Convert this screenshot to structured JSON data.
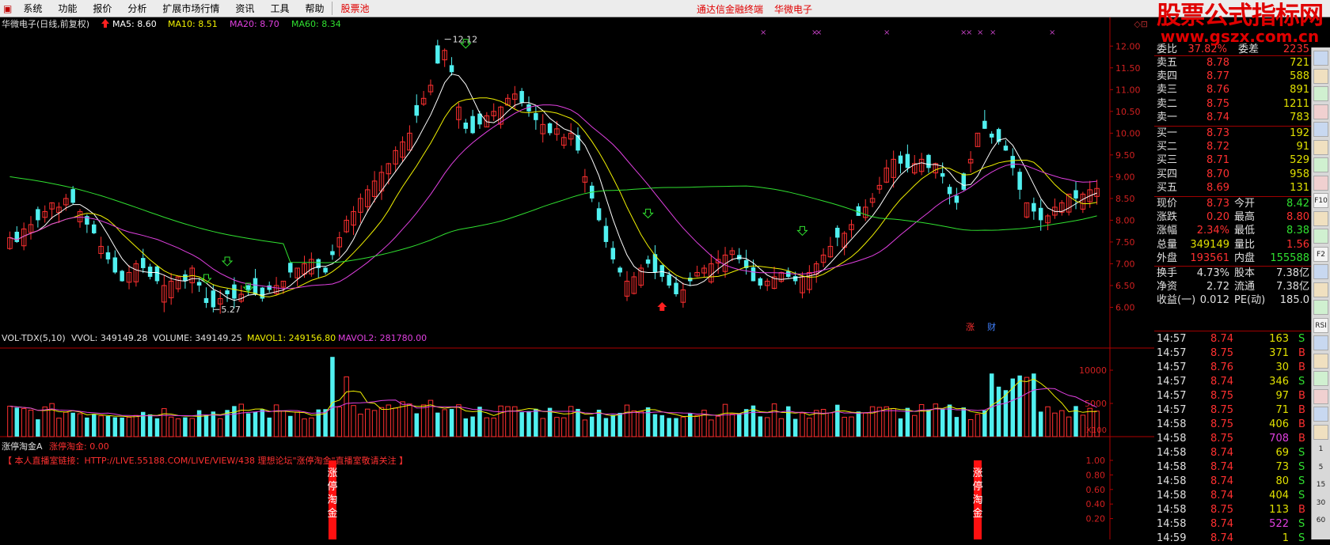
{
  "menu": {
    "items": [
      "系统",
      "功能",
      "报价",
      "分析",
      "扩展市场行情",
      "资讯",
      "工具",
      "帮助"
    ],
    "active": "股票池",
    "center": [
      "通达信金融终端",
      "华微电子"
    ]
  },
  "watermark": {
    "line1": "股票公式指标网",
    "line2": "www.gszx.com.cn"
  },
  "main_chart": {
    "title": "华微电子(日线,前复权)",
    "ma": [
      {
        "label": "MA5: 8.60",
        "color": "#ffffff"
      },
      {
        "label": "MA10: 8.51",
        "color": "#f0f000"
      },
      {
        "label": "MA20: 8.70",
        "color": "#e040e0"
      },
      {
        "label": "MA60: 8.34",
        "color": "#30e030"
      }
    ],
    "high_label": "12.12",
    "low_label": "5.27",
    "tags": [
      "涨",
      "财"
    ],
    "price_ticks": [
      "12.00",
      "11.50",
      "11.00",
      "10.50",
      "10.00",
      "9.50",
      "9.00",
      "8.50",
      "8.00",
      "7.50",
      "7.00",
      "6.50",
      "6.00"
    ],
    "top_icons": "◇⊡"
  },
  "volume_chart": {
    "title": "VOL-TDX(5,10)",
    "vvol": "VVOL: 349149.28",
    "volume": "VOLUME: 349149.25",
    "mavol1": "MAVOL1: 249156.80",
    "mavol2": "MAVOL2: 281780.00",
    "ticks": [
      "10000",
      "5000"
    ],
    "unit": "X100"
  },
  "indicator": {
    "title": "涨停淘金A",
    "value": "涨停淘金: 0.00",
    "notice": "【 本人直播室链接：HTTP://LIVE.55188.COM/LIVE/VIEW/438 理想论坛\"涨停淘金\"直播室敬请关注 】",
    "ticks": [
      "1.00",
      "0.80",
      "0.60",
      "0.40",
      "0.20"
    ],
    "signal_text": "涨停淘金"
  },
  "chart_data": {
    "type": "candlestick",
    "price_axis": {
      "min": 5.27,
      "max": 12.12,
      "ticks": [
        12.0,
        11.5,
        11.0,
        10.5,
        10.0,
        9.5,
        9.0,
        8.5,
        8.0,
        7.5,
        7.0,
        6.5,
        6.0
      ]
    },
    "volume_axis": {
      "ticks": [
        10000,
        5000
      ],
      "unit": "X100"
    },
    "indicator_axis": {
      "ticks": [
        1.0,
        0.8,
        0.6,
        0.4,
        0.2
      ]
    },
    "closes": [
      7.6,
      7.5,
      7.8,
      7.9,
      8.0,
      8.2,
      8.4,
      8.3,
      8.5,
      8.4,
      8.2,
      7.9,
      7.7,
      7.4,
      7.1,
      6.8,
      6.6,
      6.8,
      7.0,
      6.9,
      6.7,
      6.6,
      6.5,
      6.6,
      6.7,
      6.6,
      6.9,
      6.5,
      6.1,
      6.0,
      6.2,
      6.3,
      6.2,
      6.3,
      6.4,
      6.3,
      6.2,
      6.4,
      6.5,
      6.6,
      6.8,
      6.9,
      7.0,
      7.1,
      6.9,
      6.8,
      7.2,
      7.6,
      8.0,
      8.2,
      8.5,
      8.7,
      8.9,
      9.1,
      9.3,
      9.6,
      9.8,
      10.0,
      10.4,
      10.8,
      11.1,
      11.6,
      11.9,
      11.4,
      10.6,
      10.1,
      10.0,
      10.2,
      10.4,
      10.5,
      10.6,
      10.8,
      10.9,
      10.7,
      10.5,
      10.3,
      10.2,
      10.0,
      10.1,
      9.9,
      10.0,
      9.6,
      9.0,
      8.5,
      8.0,
      7.5,
      7.1,
      6.8,
      6.6,
      6.7,
      6.9,
      7.0,
      6.8,
      6.7,
      6.5,
      6.3,
      6.4,
      6.6,
      6.8,
      6.9,
      7.0,
      7.1,
      7.2,
      7.3,
      7.1,
      6.9,
      6.6,
      6.5,
      6.6,
      6.7,
      6.8,
      6.7,
      6.6,
      6.7,
      6.8,
      7.0,
      7.2,
      7.4,
      7.6,
      7.7,
      7.9,
      8.1,
      8.3,
      8.5,
      8.8,
      9.2,
      9.4,
      9.3,
      9.2,
      9.3,
      9.4,
      9.2,
      9.3,
      9.0,
      8.6,
      8.4,
      8.7,
      9.4,
      10.0,
      10.1,
      9.9,
      9.8,
      9.6,
      9.2,
      8.7,
      8.4,
      8.2,
      8.0,
      8.1,
      8.3,
      8.4,
      8.6,
      8.5,
      8.6,
      8.7,
      8.73
    ],
    "turnover_line": [
      0.0,
      0.0,
      0.0,
      0.0,
      0.0,
      0.0,
      0.0,
      0.0,
      0.0,
      0.0,
      0.0,
      0.0,
      0.0,
      0.0,
      0.0,
      0.0,
      0.0,
      0.0,
      0.0,
      0.0,
      0.0,
      0.0,
      0.0,
      0.0,
      0.0,
      0.0,
      0.0,
      0.0,
      0.0,
      0.0,
      0.0,
      0.0,
      0.0,
      0.0,
      0.0,
      0.0,
      0.0,
      0.0,
      0.0,
      0.0,
      0.0,
      0.0,
      0.0,
      0.0,
      0.0,
      0.0,
      1.0,
      0.0,
      0.0,
      0.0,
      0.0,
      0.0,
      0.0,
      0.0,
      0.0,
      0.0,
      0.0,
      0.0,
      0.0,
      0.0,
      0.0,
      0.0,
      0.0,
      0.0,
      0.0,
      0.0,
      0.0,
      0.0,
      0.0,
      0.0,
      0.0,
      0.0,
      0.0,
      0.0,
      0.0,
      0.0,
      0.0,
      0.0,
      0.0,
      0.0,
      0.0,
      0.0,
      0.0,
      0.0,
      0.0,
      0.0,
      0.0,
      0.0,
      0.0,
      0.0,
      0.0,
      0.0,
      0.0,
      0.0,
      0.0,
      0.0,
      0.0,
      0.0,
      0.0,
      0.0,
      0.0,
      0.0,
      0.0,
      0.0,
      0.0,
      0.0,
      0.0,
      0.0,
      0.0,
      0.0,
      0.0,
      0.0,
      0.0,
      0.0,
      0.0,
      0.0,
      0.0,
      0.0,
      0.0,
      0.0,
      0.0,
      0.0,
      0.0,
      0.0,
      0.0,
      0.0,
      0.0,
      0.0,
      0.0,
      0.0,
      0.0,
      0.0,
      0.0,
      0.0,
      0.0,
      0.0,
      0.0,
      0.0,
      1.0,
      0.0,
      0.0,
      0.0,
      0.0,
      0.0,
      0.0,
      0.0,
      0.0,
      0.0,
      0.0,
      0.0,
      0.0,
      0.0,
      0.0,
      0.0,
      0.0,
      0.0,
      0.0,
      0.0
    ]
  },
  "quote": {
    "header": {
      "label1": "委比",
      "value1": "37.82%",
      "label2": "委差",
      "value2": "2235"
    },
    "asks": [
      {
        "label": "卖五",
        "price": "8.78",
        "vol": "721"
      },
      {
        "label": "卖四",
        "price": "8.77",
        "vol": "588"
      },
      {
        "label": "卖三",
        "price": "8.76",
        "vol": "891"
      },
      {
        "label": "卖二",
        "price": "8.75",
        "vol": "1211"
      },
      {
        "label": "卖一",
        "price": "8.74",
        "vol": "783"
      }
    ],
    "bids": [
      {
        "label": "买一",
        "price": "8.73",
        "vol": "192"
      },
      {
        "label": "买二",
        "price": "8.72",
        "vol": "91"
      },
      {
        "label": "买三",
        "price": "8.71",
        "vol": "529"
      },
      {
        "label": "买四",
        "price": "8.70",
        "vol": "958"
      },
      {
        "label": "买五",
        "price": "8.69",
        "vol": "131"
      }
    ],
    "stats": [
      {
        "l1": "现价",
        "v1": "8.73",
        "c1": "#ff3030",
        "l2": "今开",
        "v2": "8.42",
        "c2": "#30e030"
      },
      {
        "l1": "涨跌",
        "v1": "0.20",
        "c1": "#ff3030",
        "l2": "最高",
        "v2": "8.80",
        "c2": "#ff3030"
      },
      {
        "l1": "涨幅",
        "v1": "2.34%",
        "c1": "#ff3030",
        "l2": "最低",
        "v2": "8.38",
        "c2": "#30e030"
      },
      {
        "l1": "总量",
        "v1": "349149",
        "c1": "#e0e000",
        "l2": "量比",
        "v2": "1.56",
        "c2": "#ff3030"
      },
      {
        "l1": "外盘",
        "v1": "193561",
        "c1": "#ff3030",
        "l2": "内盘",
        "v2": "155588",
        "c2": "#30e030"
      }
    ],
    "info": [
      {
        "l1": "换手",
        "v1": "4.73%",
        "l2": "股本",
        "v2": "7.38亿"
      },
      {
        "l1": "净资",
        "v1": "2.72",
        "l2": "流通",
        "v2": "7.38亿"
      },
      {
        "l1": "收益(一)",
        "v1": "0.012",
        "l2": "PE(动)",
        "v2": "185.0"
      }
    ],
    "ticks": [
      {
        "time": "14:57",
        "price": "8.74",
        "vol": "163",
        "side": "S"
      },
      {
        "time": "14:57",
        "price": "8.75",
        "vol": "371",
        "side": "B"
      },
      {
        "time": "14:57",
        "price": "8.76",
        "vol": "30",
        "side": "B"
      },
      {
        "time": "14:57",
        "price": "8.74",
        "vol": "346",
        "side": "S"
      },
      {
        "time": "14:57",
        "price": "8.75",
        "vol": "97",
        "side": "B"
      },
      {
        "time": "14:57",
        "price": "8.75",
        "vol": "71",
        "side": "B"
      },
      {
        "time": "14:58",
        "price": "8.75",
        "vol": "406",
        "side": "B"
      },
      {
        "time": "14:58",
        "price": "8.75",
        "vol": "708",
        "side": "B"
      },
      {
        "time": "14:58",
        "price": "8.74",
        "vol": "69",
        "side": "S"
      },
      {
        "time": "14:58",
        "price": "8.74",
        "vol": "73",
        "side": "S"
      },
      {
        "time": "14:58",
        "price": "8.74",
        "vol": "80",
        "side": "S"
      },
      {
        "time": "14:58",
        "price": "8.74",
        "vol": "404",
        "side": "S"
      },
      {
        "time": "14:58",
        "price": "8.75",
        "vol": "113",
        "side": "B"
      },
      {
        "time": "14:58",
        "price": "8.74",
        "vol": "522",
        "side": "S"
      },
      {
        "time": "14:59",
        "price": "8.74",
        "vol": "1",
        "side": "S"
      }
    ]
  },
  "toolbar": {
    "labels": [
      "",
      "",
      "",
      "",
      "",
      "",
      "",
      "",
      "F10",
      "",
      "",
      "F2",
      "",
      "",
      "",
      "RSI",
      "",
      "",
      "",
      "",
      "",
      "",
      "1",
      "5",
      "15",
      "30",
      "60"
    ]
  }
}
